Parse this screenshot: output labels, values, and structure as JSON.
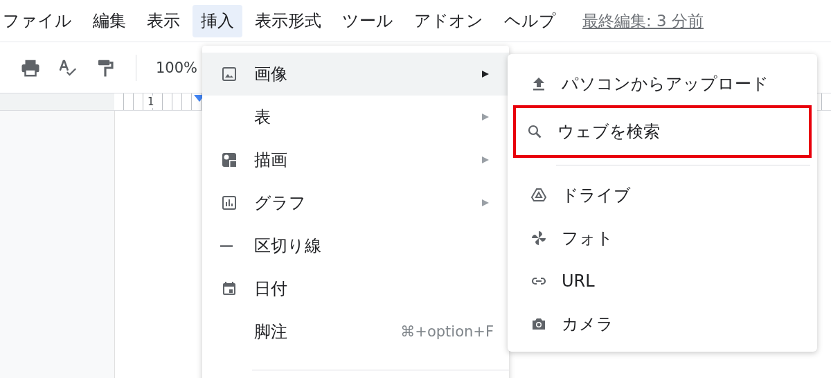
{
  "menubar": {
    "items": [
      {
        "label": "ファイル",
        "selected": false
      },
      {
        "label": "編集",
        "selected": false
      },
      {
        "label": "表示",
        "selected": false
      },
      {
        "label": "挿入",
        "selected": true
      },
      {
        "label": "表示形式",
        "selected": false
      },
      {
        "label": "ツール",
        "selected": false
      },
      {
        "label": "アドオン",
        "selected": false
      },
      {
        "label": "ヘルプ",
        "selected": false
      }
    ],
    "last_edit": "最終編集: 3 分前"
  },
  "toolbar": {
    "zoom": "100%"
  },
  "ruler": {
    "mark": "1"
  },
  "insert_menu": {
    "items": [
      {
        "label": "画像",
        "submenu": true,
        "selected": true
      },
      {
        "label": "表",
        "submenu": true,
        "selected": false
      },
      {
        "label": "描画",
        "submenu": true,
        "selected": false
      },
      {
        "label": "グラフ",
        "submenu": true,
        "selected": false
      },
      {
        "label": "区切り線",
        "submenu": false,
        "selected": false
      },
      {
        "label": "日付",
        "submenu": false,
        "selected": false
      },
      {
        "label": "脚注",
        "shortcut": "⌘+option+F",
        "submenu": false,
        "selected": false
      }
    ]
  },
  "image_submenu": {
    "items": [
      {
        "label": "パソコンからアップロード",
        "annotated": false
      },
      {
        "label": "ウェブを検索",
        "annotated": true
      },
      {
        "kind": "divider"
      },
      {
        "label": "ドライブ",
        "annotated": false
      },
      {
        "label": "フォト",
        "annotated": false
      },
      {
        "label": "URL",
        "annotated": false
      },
      {
        "label": "カメラ",
        "annotated": false
      }
    ]
  }
}
